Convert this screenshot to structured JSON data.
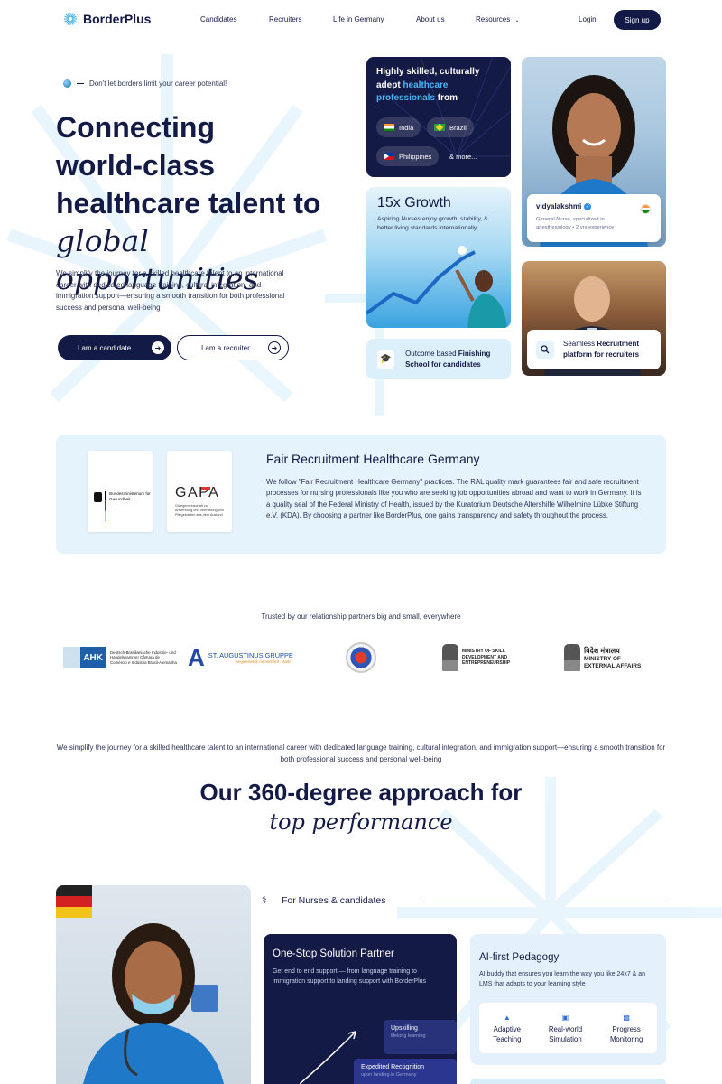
{
  "brand": {
    "name": "BorderPlus",
    "navy": "#141a46",
    "accent": "#4db5f2",
    "light_panel": "#e4f3fc"
  },
  "nav": {
    "links": [
      "Candidates",
      "Recruiters",
      "Life in Germany",
      "About us",
      "Resources"
    ],
    "login": "Login",
    "signup": "Sign up"
  },
  "hero": {
    "tagline": "Don't let borders limit your career potential!",
    "title_line1": "Connecting",
    "title_line2": "world-class",
    "title_line3": "healthcare talent to",
    "title_line4": "global opportunities",
    "description": "We simplify the journey for a skilled healthcare talent to an international career with dedicated language training, cultural integration, and immigration support—ensuring a smooth transition for both professional success and personal well-being",
    "btn_candidate": "I am a candidate",
    "btn_recruiter": "I am a recruiter"
  },
  "cards": {
    "skilled_pre": "Highly skilled, culturally adept ",
    "skilled_hl": "healthcare professionals",
    "skilled_post": " from",
    "countries": [
      "India",
      "Brazil",
      "Philippines",
      "& more..."
    ],
    "profile_name": "vidyalakshmi",
    "profile_role": "General Nurse, specialized in anesthesiology • 2 yrs experience",
    "growth_title": "15x Growth",
    "growth_desc": "Aspiring Nurses enjoy growth, stability, & better living standards internationally",
    "finishing_pre": "Outcome based ",
    "finishing_bold": "Finishing School for candidates",
    "recruit_pre": "Seamless ",
    "recruit_bold": "Recruitment platform for recruiters"
  },
  "fair": {
    "title": "Fair Recruitment Healthcare Germany",
    "body": "We follow \"Fair Recruitment Healthcare Germany\" practices. The RAL quality mark guarantees fair and safe recruitment processes for nursing professionals like you who are seeking job opportunities abroad and want to work in Germany. It is a quality seal of the Federal Ministry of Health, issued by the Kuratorium Deutsche Altershilfe Wilhelmine Lübke Stiftung e.V. (KDA). By choosing a partner like BorderPlus, one gains transparency and safety throughout the process.",
    "logo1_text": "Bundesministerium für Gesundheit",
    "logo2_title": "GAPA",
    "logo2_text": "Gütegemeinschaft zur Anwerbung und Vermittlung von Pflegekräften aus dem Ausland"
  },
  "partners": {
    "heading": "Trusted by our relationship partners big and small, everywhere",
    "ahk_mark": "AHK",
    "ahk_text": "Deutsch-Brasilianische Industrie- und Handelskammer Câmara de Comércio e Indústria Brasil-Alemanha",
    "augustinus_name": "ST. AUGUSTINUS GRUPPE",
    "augustinus_tag": "wegweisend. menschlich. stark.",
    "msde": "MINISTRY OF SKILL DEVELOPMENT AND ENTREPRENEURSHIP",
    "mea_hindi": "विदेश मंत्रालय",
    "mea": "MINISTRY OF EXTERNAL AFFAIRS"
  },
  "approach": {
    "intro": "We simplify the journey for a skilled healthcare talent to an international career with dedicated language training, cultural integration, and immigration support—ensuring a smooth transition for both professional success and personal well-being",
    "title_line1": "Our 360-degree approach for",
    "title_line2": "top performance",
    "section_label": "For Nurses & candidates",
    "onestop_title": "One-Stop Solution Partner",
    "onestop_desc": "Get end to end support — from language training to immigration support to landing support with BorderPlus",
    "upskilling": "Upskilling",
    "upskilling_sub": "lifelong learning",
    "expedited": "Expedited Recognition",
    "expedited_sub": "upon landing in Germany",
    "ai_title": "AI-first Pedagogy",
    "ai_desc": "AI buddy that ensures you learn the way you like 24x7 & an LMS that adapts to your learning style",
    "ai_items": [
      "Adaptive Teaching",
      "Real-world Simulation",
      "Progress Monitoring"
    ]
  }
}
